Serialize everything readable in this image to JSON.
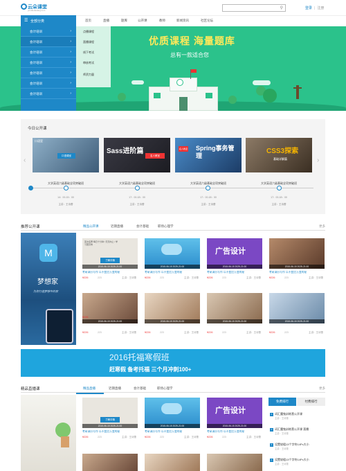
{
  "header": {
    "logo_name": "云朵课堂",
    "logo_sub": "yunduoketang.com",
    "search_placeholder": "",
    "login": "登录",
    "separator": "|",
    "register": "注册"
  },
  "nav": {
    "all_categories": "全部分类",
    "items": [
      "首页",
      "直播",
      "题库",
      "公开课",
      "教师",
      "新闻资讯",
      "社区论坛"
    ]
  },
  "sidebar": {
    "items": [
      "会计培训",
      "会计培训",
      "会计培训",
      "会计培训",
      "会计培训",
      "会计培训",
      "会计培训"
    ]
  },
  "submenu": {
    "items": [
      "点播课程",
      "直播课程",
      "线下考试",
      "审核考试",
      "师资力量"
    ]
  },
  "hero": {
    "title": "优质课程   海量题库",
    "subtitle": "总有一款适合您"
  },
  "today": {
    "title": "今日公开课",
    "cards": [
      {
        "label": "大学英语六级基础全项突破班",
        "time": "14：00-15：00",
        "lecturer": "主讲：王诗蕾",
        "img_text": "口语室",
        "img_badge": "口语课室"
      },
      {
        "label": "大学英语六级基础全项突破班",
        "time": "17：00-18：00",
        "lecturer": "主讲：王诗蕾",
        "img_text": "Sass进阶篇",
        "img_badge": "名人教室"
      },
      {
        "label": "大学英语六级基础全项突破班",
        "time": "17：00-18：00",
        "lecturer": "主讲：王诗蕾",
        "img_text": "Spring事务管理",
        "img_badge": "名人教室"
      },
      {
        "label": "大学英语六级基础全项突破班",
        "time": "17：00-18：00",
        "lecturer": "主讲：王诗蕾",
        "img_text": "CSS3探索",
        "img_badge": "基础详解篇"
      }
    ]
  },
  "rec": {
    "title": "推荐公开课",
    "tabs": [
      "精品公开课",
      "近期直播",
      "会计基础",
      "职场心理学"
    ],
    "more": "更多",
    "banner_title": "梦想家",
    "banner_sub": "为你打造梦想中的家",
    "cards": [
      {
        "date": "2015-06-15   2025-21:00",
        "title": "考研满分写作 以不变应万变的秘",
        "price": "¥226",
        "people": "223",
        "lecturer": "主讲：王诗蕾",
        "img_btn": "了解详情"
      },
      {
        "date": "2015-06-15   2025-21:00",
        "title": "考研满分写作 以不变应万变的秘",
        "price": "¥226",
        "people": "223",
        "lecturer": "主讲：王诗蕾",
        "img_btn": ""
      },
      {
        "date": "2015-06-15   2025-21:00",
        "title": "考研满分写作 以不变应万变的秘",
        "price": "¥226",
        "people": "223",
        "lecturer": "主讲：王诗蕾",
        "img_btn": "广告设计"
      },
      {
        "date": "2015-06-15   2025-21:00",
        "title": "考研满分写作 以不变应万变的秘",
        "price": "¥226",
        "people": "223",
        "lecturer": "主讲：王诗蕾",
        "img_btn": ""
      },
      {
        "date": "2015-06-15   2025-21:00",
        "title": "考研满分写作 以不变应万变的秘",
        "price": "¥226",
        "people": "223",
        "lecturer": "主讲：王诗蕾",
        "img_btn": ""
      },
      {
        "date": "2015-06-15   2025-21:00",
        "title": "考研满分写作 以不变应万变的秘",
        "price": "¥226",
        "people": "223",
        "lecturer": "主讲：王诗蕾",
        "img_btn": ""
      },
      {
        "date": "2015-06-15   2025-21:00",
        "title": "考研满分写作 以不变应万变的秘",
        "price": "¥226",
        "people": "223",
        "lecturer": "主讲：王诗蕾",
        "img_btn": ""
      },
      {
        "date": "2015-06-15   2025-21:00",
        "title": "考研满分写作 以不变应万变的秘",
        "price": "¥226",
        "people": "223",
        "lecturer": "主讲：王诗蕾",
        "img_btn": ""
      }
    ]
  },
  "ad": {
    "title": "2016托福寒假班",
    "subtitle": "赶寒假   备考托福   三个月冲刺100+"
  },
  "live": {
    "title": "精品直播课",
    "tabs": [
      "精品直播",
      "近期直播",
      "会计基础",
      "职场心理学"
    ],
    "more": "更多",
    "cards": [
      {
        "date": "2015-06-15   2025-21:00",
        "title": "考研满分写作 以不变应万变的秘",
        "price": "¥226",
        "people": "223",
        "lecturer": "主讲：王诗蕾"
      },
      {
        "date": "2015-06-15   2025-21:00",
        "title": "考研满分写作 以不变应万变的秘",
        "price": "¥226",
        "people": "223",
        "lecturer": "主讲：王诗蕾"
      },
      {
        "date": "2015-06-15   2025-21:00",
        "title": "考研满分写作 以不变应万变的秘",
        "price": "¥226",
        "people": "223",
        "lecturer": "主讲：王诗蕾"
      }
    ],
    "rank_tabs": [
      "免费排行",
      "付费排行"
    ],
    "rank_items": [
      {
        "num": "1",
        "title": "词汇魔鬼训练营公开课",
        "detail": "主讲：王诗蕾"
      },
      {
        "num": "2",
        "title": "词汇魔鬼训练营公开课 直播",
        "detail": "主讲：王诗蕾"
      },
      {
        "num": "3",
        "title": "设置较粗13个字符14Px大小",
        "detail": "主讲：王诗蕾"
      },
      {
        "num": "4",
        "title": "设置较粗13个字符14Px大小",
        "detail": "主讲：王诗蕾"
      }
    ]
  },
  "colors": {
    "brand": "#1e88c8",
    "hero": "#2bc28b",
    "price": "#ee3333"
  }
}
